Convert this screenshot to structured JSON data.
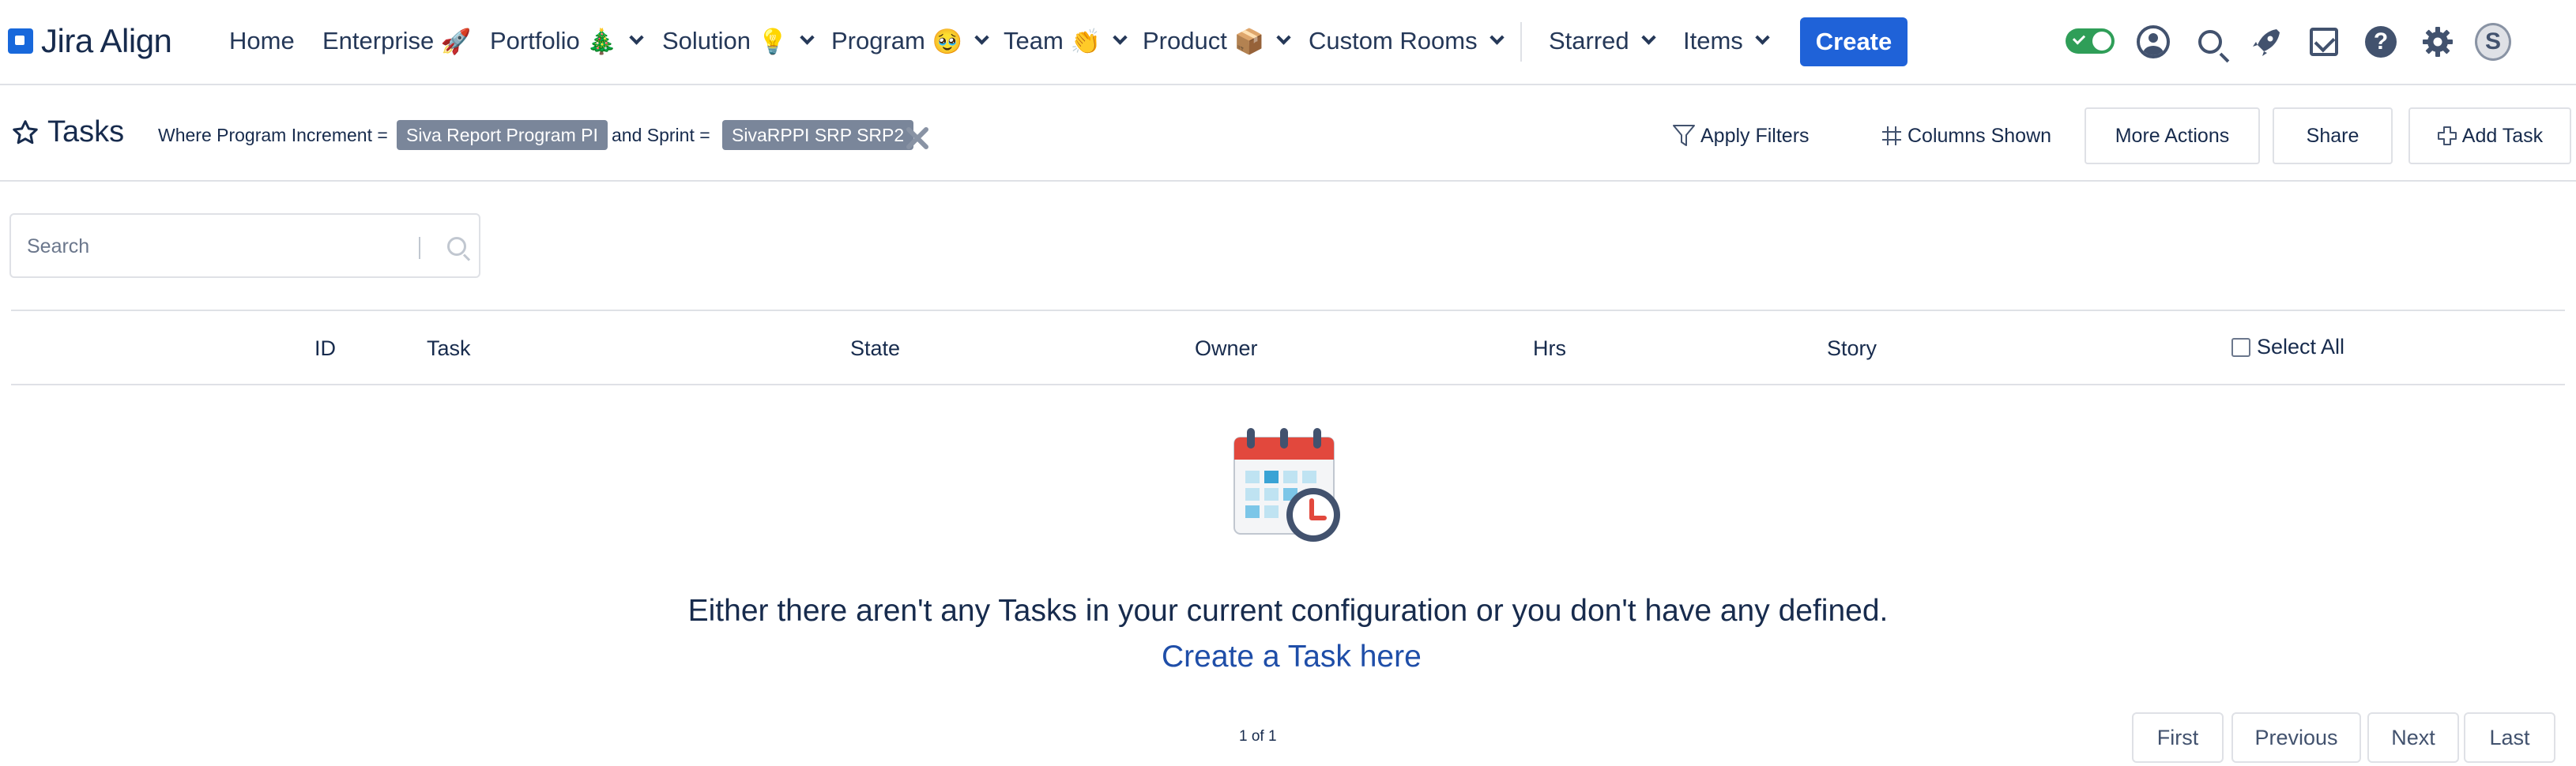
{
  "brand": {
    "name": "Jira Align"
  },
  "nav": {
    "items": [
      {
        "label": "Home",
        "emoji": "",
        "dropdown": false
      },
      {
        "label": "Enterprise",
        "emoji": "🚀",
        "dropdown": false
      },
      {
        "label": "Portfolio",
        "emoji": "🎄",
        "dropdown": true
      },
      {
        "label": "Solution",
        "emoji": "💡",
        "dropdown": true
      },
      {
        "label": "Program",
        "emoji": "🥹",
        "dropdown": true
      },
      {
        "label": "Team",
        "emoji": "👏",
        "dropdown": true
      },
      {
        "label": "Product",
        "emoji": "📦",
        "dropdown": true
      },
      {
        "label": "Custom Rooms",
        "emoji": "",
        "dropdown": true
      },
      {
        "label": "Starred",
        "emoji": "",
        "dropdown": true
      },
      {
        "label": "Items",
        "emoji": "",
        "dropdown": true
      }
    ],
    "create_label": "Create",
    "icons": [
      "toggle-switch",
      "user-profile-icon",
      "search-icon",
      "notifications-rocket-icon",
      "task-checkbox-icon",
      "help-icon",
      "settings-gear-icon",
      "user-avatar"
    ],
    "user_initial": "S"
  },
  "page": {
    "title": "Tasks",
    "filter": {
      "prefix": "Where Program Increment =",
      "pi_chip": "Siva Report Program PI",
      "joiner": "and Sprint =",
      "sprint_chip": "SivaRPPI SRP SRP2"
    },
    "actions": {
      "apply_filters": "Apply Filters",
      "columns_shown": "Columns Shown",
      "more_actions": "More Actions",
      "share": "Share",
      "add_task": "Add Task"
    }
  },
  "search": {
    "placeholder": "Search"
  },
  "table": {
    "columns": [
      "ID",
      "Task",
      "State",
      "Owner",
      "Hrs",
      "Story"
    ],
    "select_all_label": "Select All",
    "rows": []
  },
  "empty_state": {
    "message": "Either there aren't any Tasks in your current configuration or you don't have any defined.",
    "link": "Create a Task here"
  },
  "pagination": {
    "status": "1 of 1",
    "first": "First",
    "previous": "Previous",
    "next": "Next",
    "last": "Last"
  },
  "colors": {
    "primary": "#1f62d8",
    "toggle_on": "#2f9e58",
    "chip_bg": "#7a869a",
    "link": "#1f4ea8",
    "text": "#172b4d",
    "border": "#dfe1e6"
  }
}
